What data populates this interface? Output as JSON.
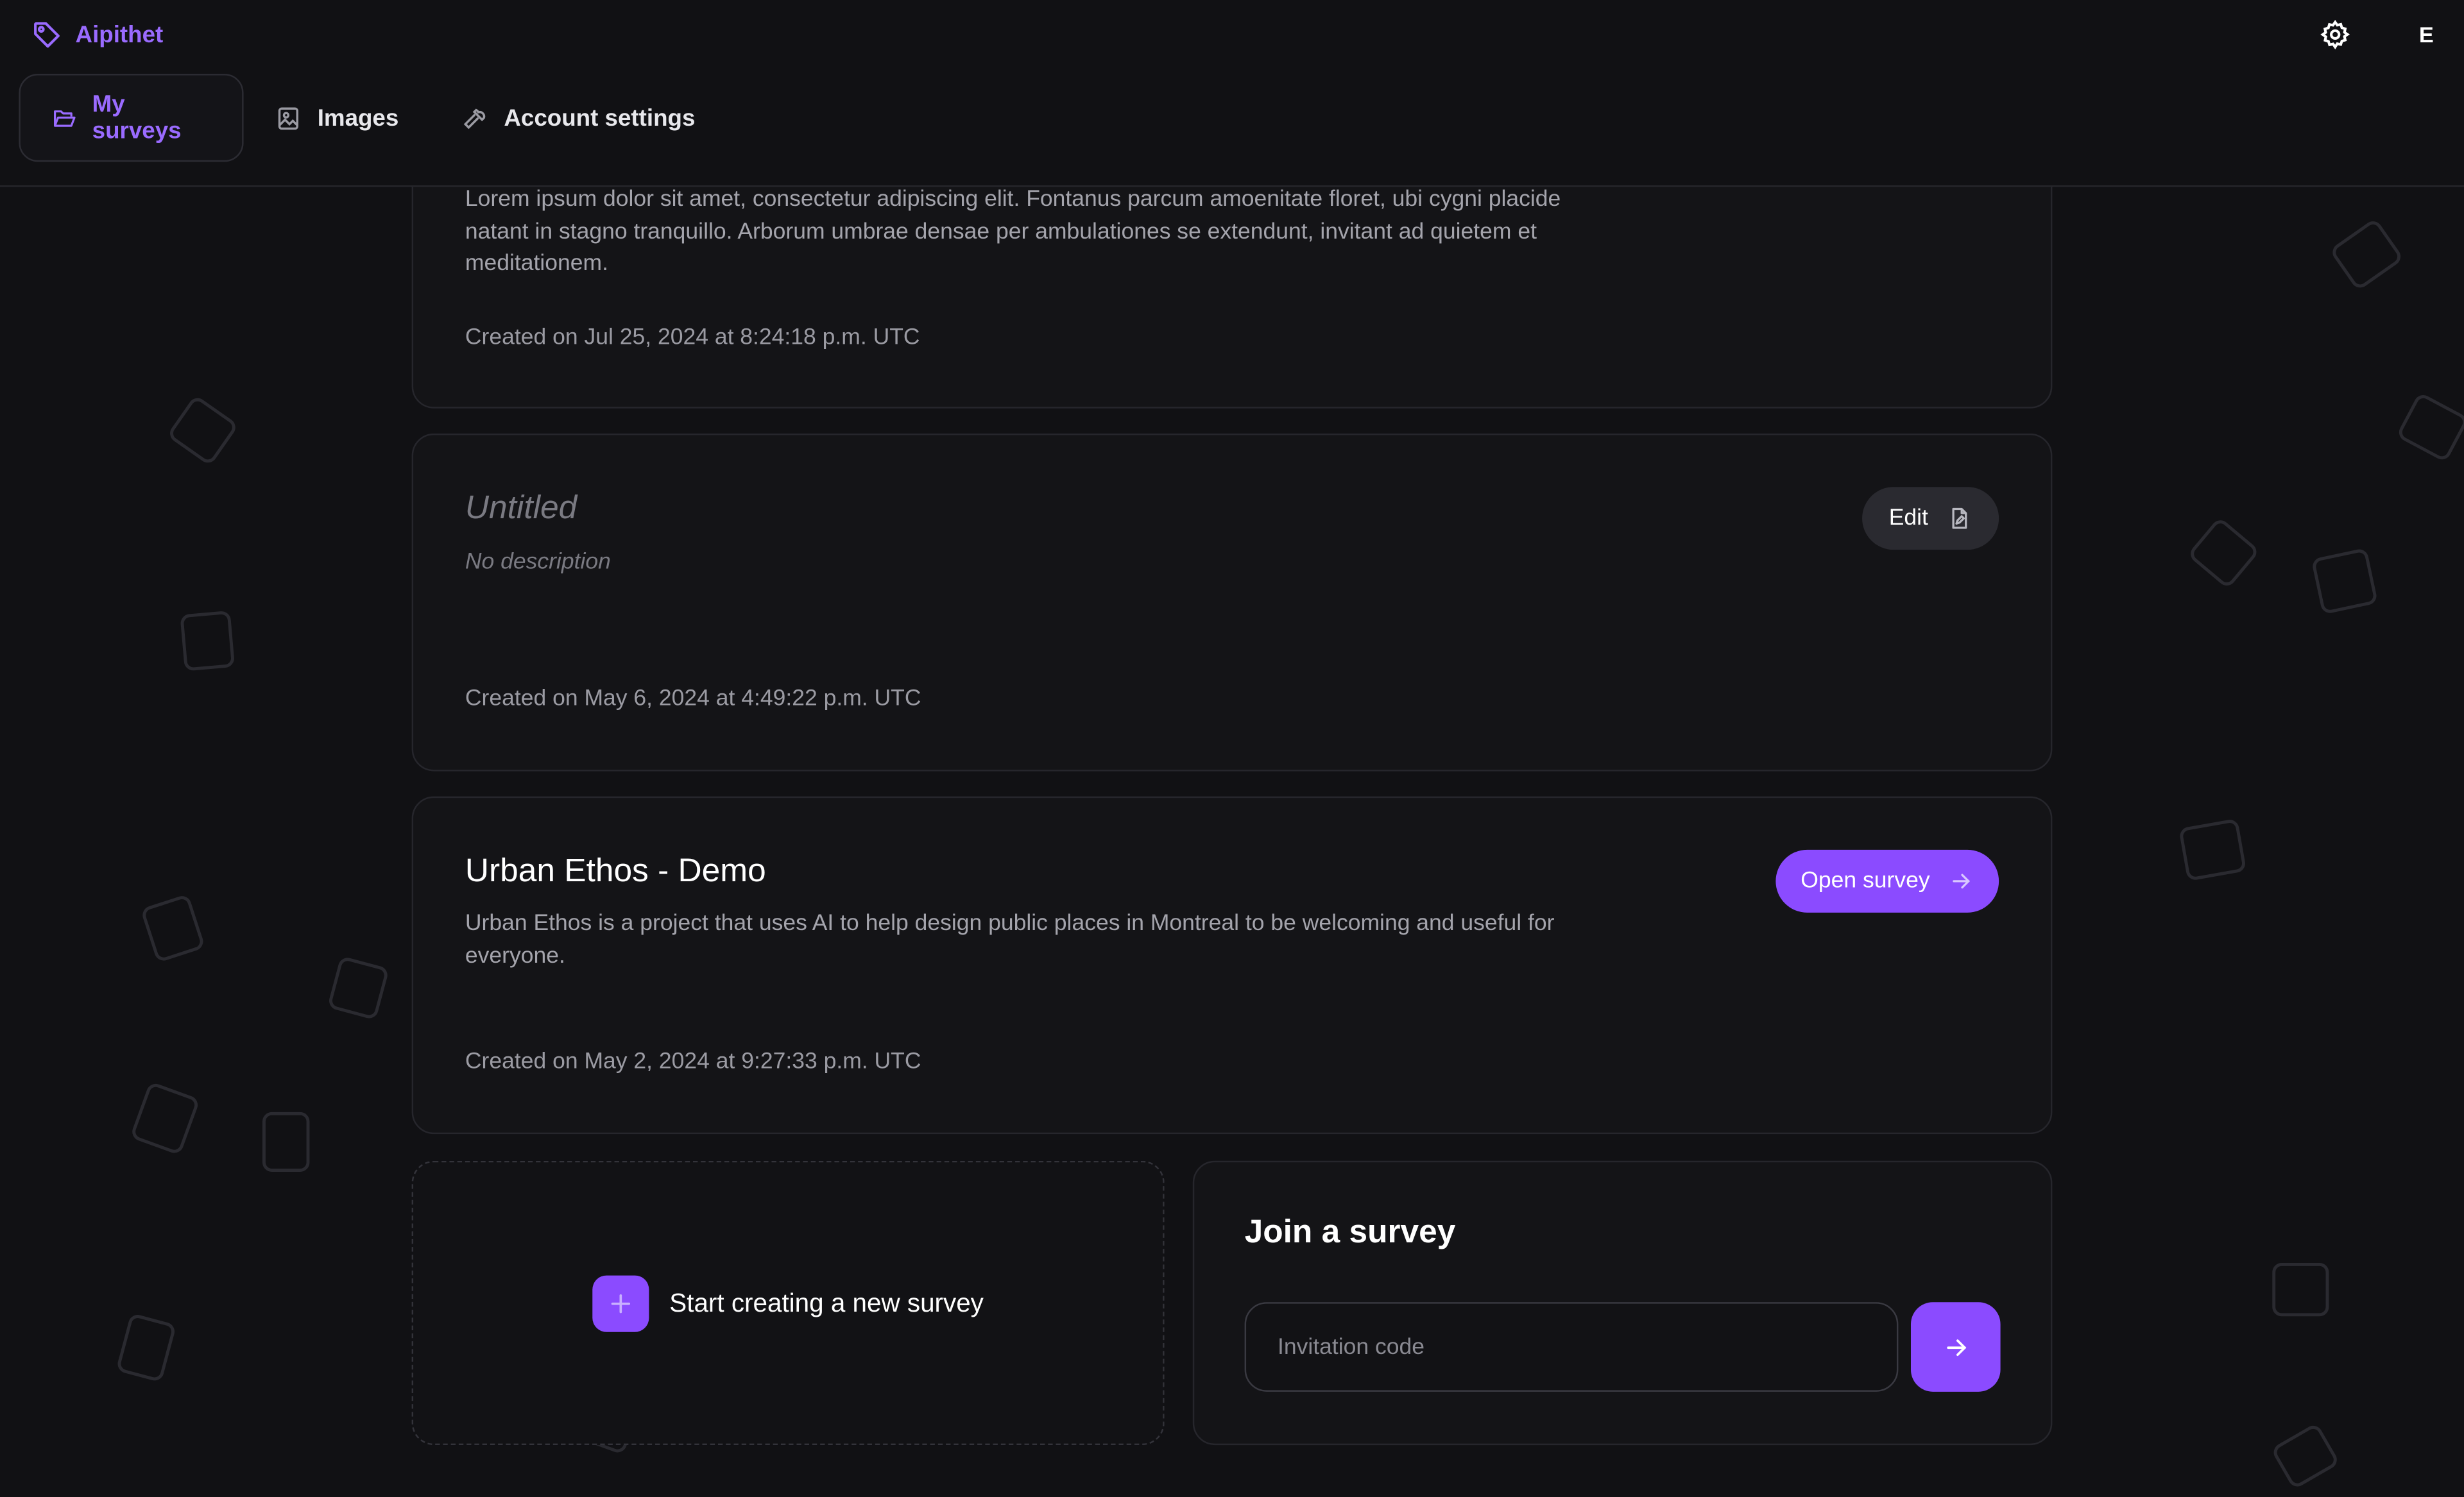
{
  "app": {
    "brand": "Aipithet",
    "avatar_initial": "E"
  },
  "tabs": [
    {
      "label": "My surveys",
      "icon": "folder-open-icon",
      "active": true
    },
    {
      "label": "Images",
      "icon": "image-icon",
      "active": false
    },
    {
      "label": "Account settings",
      "icon": "wrench-icon",
      "active": false
    }
  ],
  "surveys": [
    {
      "title": "",
      "description": "Lorem ipsum dolor sit amet, consectetur adipiscing elit. Fontanus parcum amoenitate floret, ubi cygni placide natant in stagno tranquillo. Arborum umbrae densae per ambulationes se extendunt, invitant ad quietem et meditationem.",
      "created": "Created on Jul 25, 2024 at 8:24:18 p.m. UTC"
    },
    {
      "title": "Untitled",
      "description": "No description",
      "created": "Created on May 6, 2024 at 4:49:22 p.m. UTC",
      "action_label": "Edit"
    },
    {
      "title": "Urban Ethos - Demo",
      "description": "Urban Ethos is a project that uses AI to help design public places in Montreal to be welcoming and useful for everyone.",
      "created": "Created on May 2, 2024 at 9:27:33 p.m. UTC",
      "action_label": "Open survey"
    }
  ],
  "create": {
    "label": "Start creating a new survey"
  },
  "join": {
    "title": "Join a survey",
    "placeholder": "Invitation code"
  },
  "colors": {
    "accent": "#8b4bff",
    "brand": "#9a6bff",
    "background": "#111114"
  }
}
